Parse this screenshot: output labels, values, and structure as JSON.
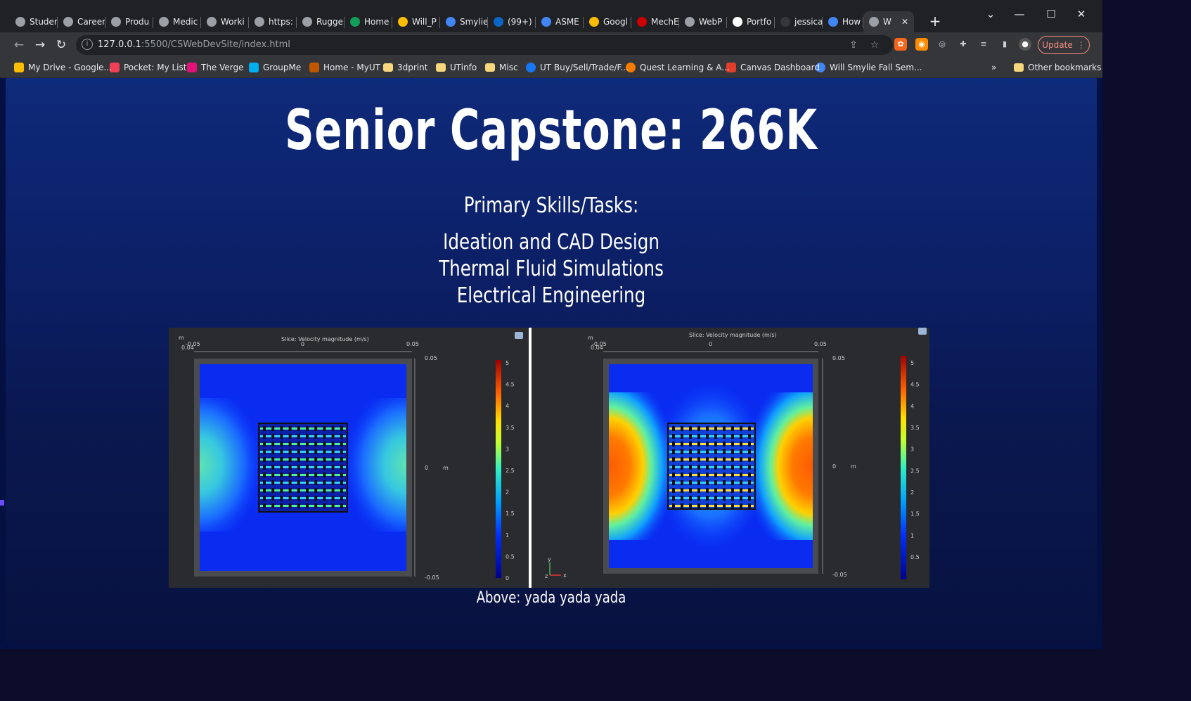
{
  "tabs": [
    {
      "label": "Studer",
      "icon": "globe-icon",
      "color": "#9aa0a6"
    },
    {
      "label": "Career",
      "icon": "globe-icon",
      "color": "#9aa0a6"
    },
    {
      "label": "Produ",
      "icon": "globe-icon",
      "color": "#9aa0a6"
    },
    {
      "label": "Medic",
      "icon": "globe-icon",
      "color": "#9aa0a6"
    },
    {
      "label": "Worki",
      "icon": "globe-icon",
      "color": "#9aa0a6"
    },
    {
      "label": "https:",
      "icon": "globe-icon",
      "color": "#9aa0a6"
    },
    {
      "label": "Rugge",
      "icon": "globe-icon",
      "color": "#9aa0a6"
    },
    {
      "label": "Home",
      "icon": "sheets-icon",
      "color": "#0f9d58"
    },
    {
      "label": "Will_P",
      "icon": "drive-icon",
      "color": "#fbbc04"
    },
    {
      "label": "Smylie",
      "icon": "docs-icon",
      "color": "#4285f4"
    },
    {
      "label": "(99+)",
      "icon": "linkedin-icon",
      "color": "#0a66c2"
    },
    {
      "label": "ASME",
      "icon": "docs-icon",
      "color": "#4285f4"
    },
    {
      "label": "Googl",
      "icon": "keep-icon",
      "color": "#fbbc04"
    },
    {
      "label": "MechE",
      "icon": "bu-icon",
      "color": "#cc0000"
    },
    {
      "label": "WebP",
      "icon": "globe-icon",
      "color": "#9aa0a6"
    },
    {
      "label": "Portfo",
      "icon": "portfolio-icon",
      "color": "#ffffff"
    },
    {
      "label": "jessica",
      "icon": "blank-icon",
      "color": "#35363a"
    },
    {
      "label": "How t",
      "icon": "info-icon",
      "color": "#4285f4"
    },
    {
      "label": "W",
      "icon": "globe-icon",
      "color": "#9aa0a6",
      "active": true
    }
  ],
  "toolbar": {
    "url_host": "127.0.0.1",
    "url_path": ":5500/CSWebDevSite/index.html",
    "update_label": "Update"
  },
  "bookmarks": [
    {
      "label": "My Drive - Google...",
      "icon": "drive-icon",
      "color": "#fbbc04"
    },
    {
      "label": "Pocket: My List",
      "icon": "pocket-icon",
      "color": "#ef4056"
    },
    {
      "label": "The Verge",
      "icon": "verge-icon",
      "color": "#e2127a"
    },
    {
      "label": "GroupMe",
      "icon": "groupme-icon",
      "color": "#00aff0"
    },
    {
      "label": "Home - MyUT",
      "icon": "ut-icon",
      "color": "#bf5700"
    },
    {
      "label": "3dprint",
      "icon": "folder-icon",
      "color": "#f6d77e"
    },
    {
      "label": "UTinfo",
      "icon": "folder-icon",
      "color": "#f6d77e"
    },
    {
      "label": "Misc",
      "icon": "folder-icon",
      "color": "#f6d77e"
    },
    {
      "label": "UT Buy/Sell/Trade/F...",
      "icon": "facebook-icon",
      "color": "#1877f2"
    },
    {
      "label": "Quest Learning & A...",
      "icon": "quest-icon",
      "color": "#f57c00"
    },
    {
      "label": "Canvas Dashboard",
      "icon": "canvas-icon",
      "color": "#e13f2b"
    },
    {
      "label": "Will Smylie Fall Sem...",
      "icon": "google-icon",
      "color": "#4285f4"
    }
  ],
  "bookmarks_overflow": "»",
  "other_bookmarks": "Other bookmarks",
  "page": {
    "title": "Senior Capstone: 266K",
    "skills_heading": "Primary Skills/Tasks:",
    "skills": [
      "Ideation and CAD Design",
      "Thermal Fluid Simulations",
      "Electrical Engineering"
    ],
    "caption": "Above: yada yada yada"
  },
  "figure": {
    "plot_title": "Slice: Velocity magnitude (m/s)",
    "unit": "m",
    "x_ticks": [
      "-0.05",
      "0",
      "0.05"
    ],
    "y_ticks": [
      "0.05",
      "0",
      "-0.05"
    ],
    "corner_tick": "0.04",
    "colorbar_left": [
      "5",
      "4.5",
      "4",
      "3.5",
      "3",
      "2.5",
      "2",
      "1.5",
      "1",
      "0.5",
      "0"
    ],
    "colorbar_right": [
      "5",
      "4.5",
      "4",
      "3.5",
      "3",
      "2.5",
      "2",
      "1.5",
      "1",
      "0.5"
    ],
    "axis_y": "y",
    "axis_x": "x",
    "axis_z": "z"
  }
}
